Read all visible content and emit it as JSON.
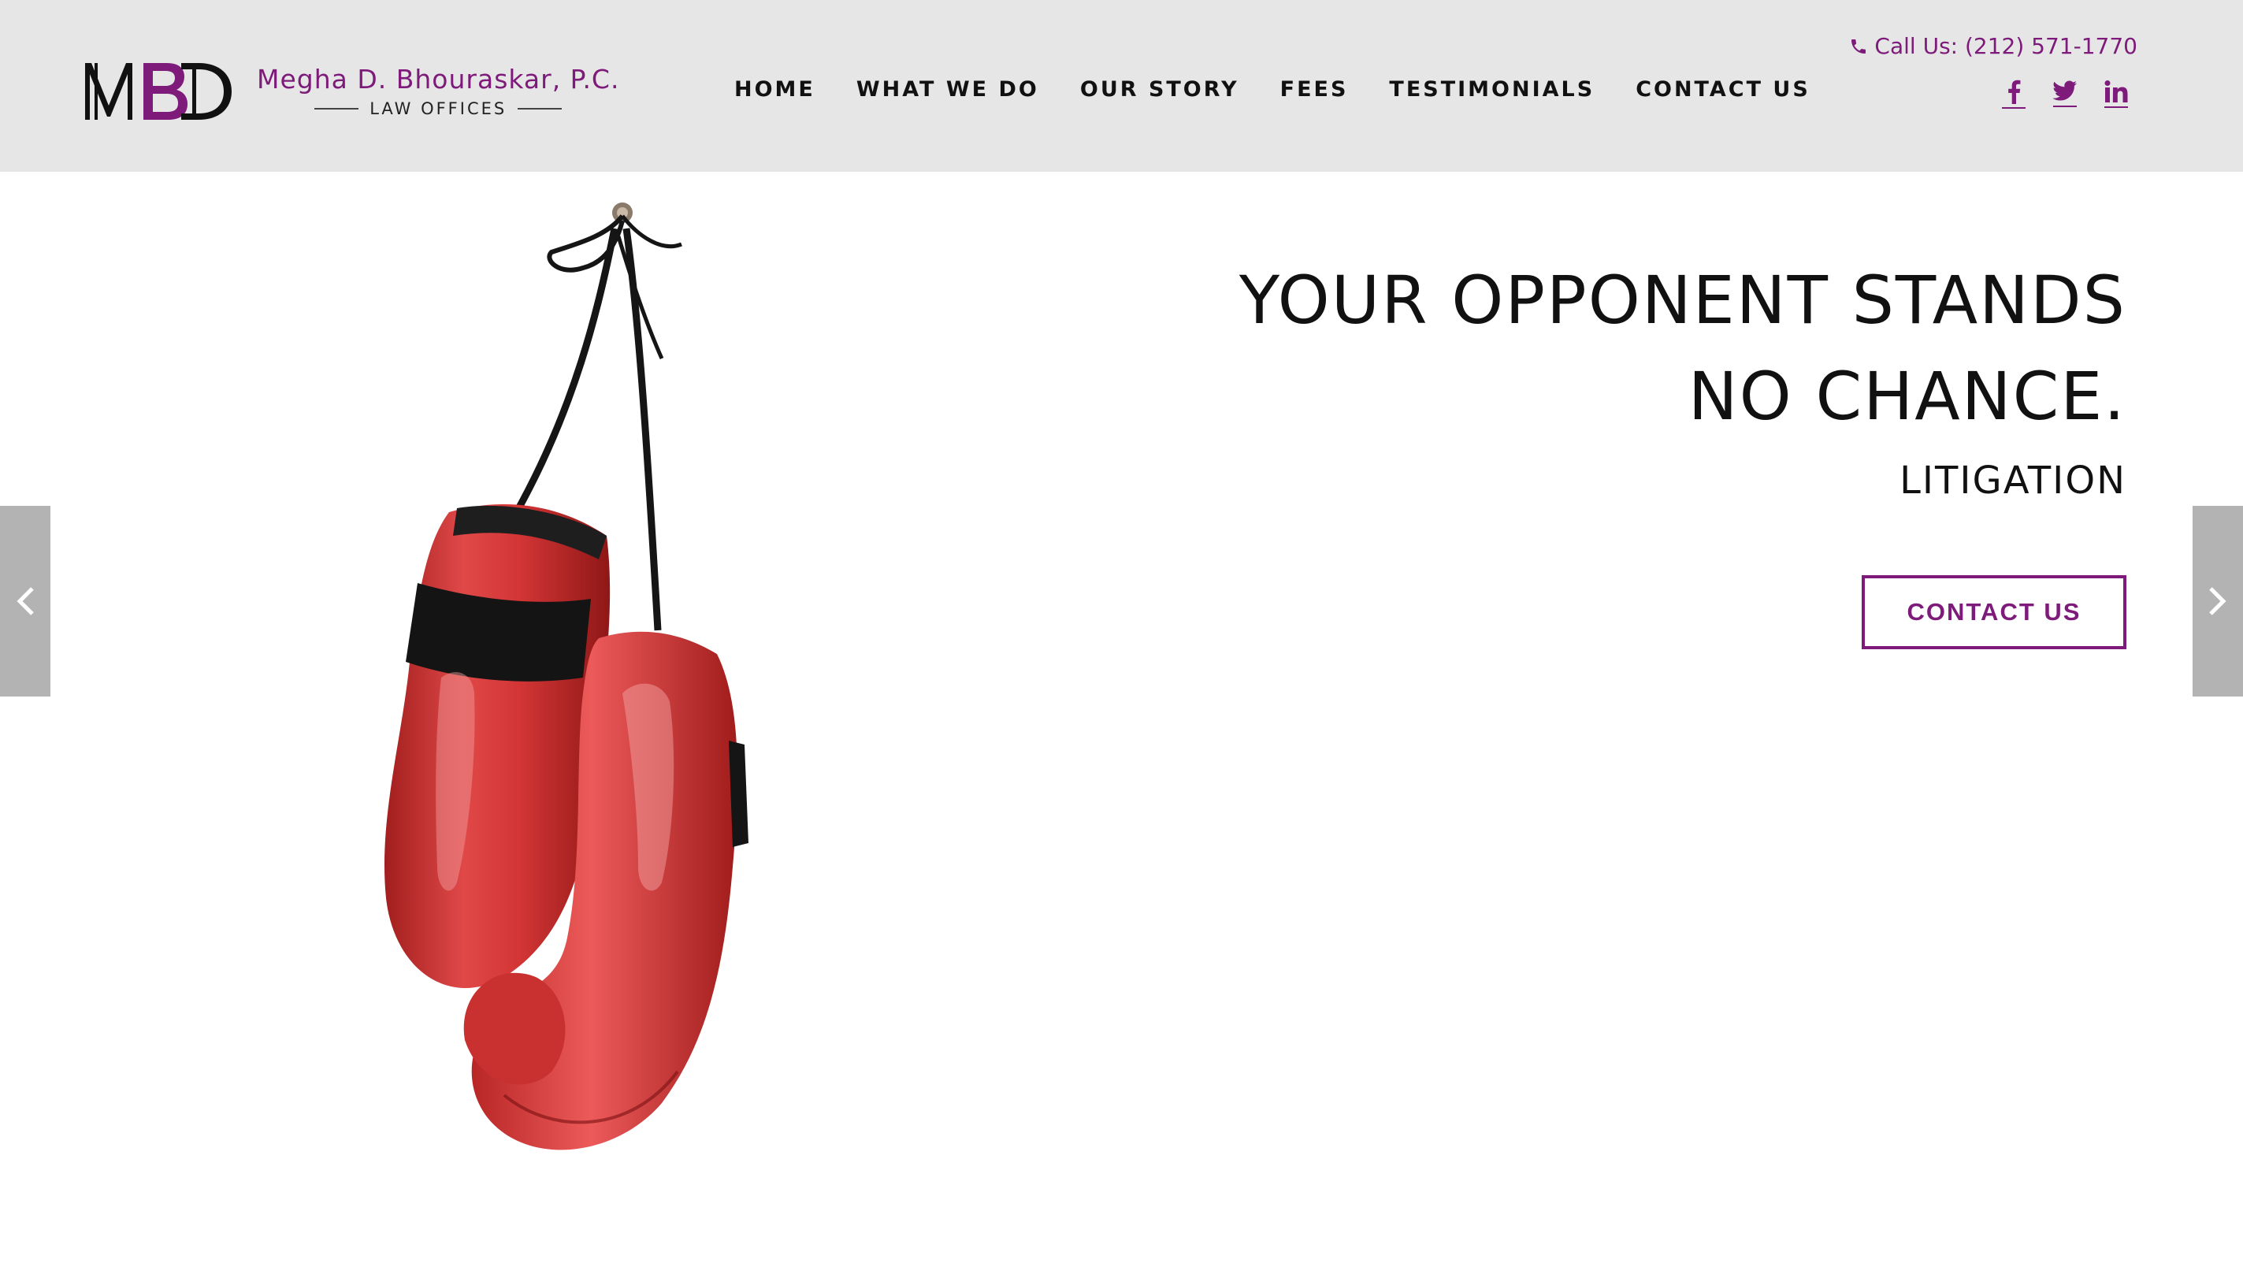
{
  "brand": {
    "mark": "MBD",
    "name": "Megha D. Bhouraskar, P.C.",
    "subtitle": "LAW OFFICES",
    "accent_color": "#7d1a7a"
  },
  "nav": {
    "items": [
      {
        "label": "HOME"
      },
      {
        "label": "WHAT WE DO"
      },
      {
        "label": "OUR STORY"
      },
      {
        "label": "FEES"
      },
      {
        "label": "TESTIMONIALS"
      },
      {
        "label": "CONTACT US"
      }
    ]
  },
  "contact": {
    "phone_label": "Call Us: (212) 571-1770",
    "phone_icon": "phone-icon"
  },
  "social": {
    "icons": [
      "facebook-icon",
      "twitter-icon",
      "linkedin-icon"
    ]
  },
  "hero": {
    "headline_line1": "YOUR OPPONENT STANDS",
    "headline_line2": "NO CHANCE.",
    "subhead": "LITIGATION",
    "cta_label": "CONTACT US",
    "image": "boxing-gloves"
  },
  "slider": {
    "prev_icon": "chevron-left-icon",
    "next_icon": "chevron-right-icon"
  }
}
